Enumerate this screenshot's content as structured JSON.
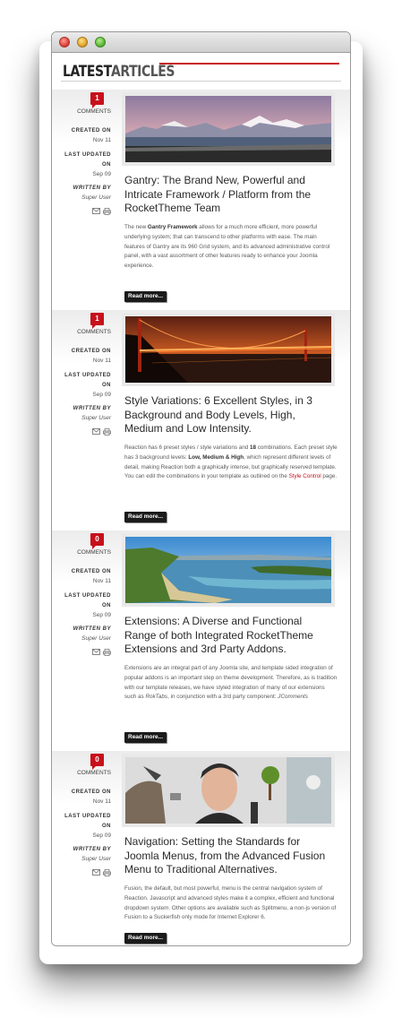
{
  "header": {
    "title_strong": "LATEST",
    "title_light": "ARTICLES"
  },
  "colors": {
    "accent": "#c7101b",
    "dark_button": "#1b1b1b"
  },
  "meta_labels": {
    "comments": "COMMENTS",
    "created": "CREATED ON",
    "updated_1": "LAST UPDATED",
    "updated_2": "ON",
    "written": "WRITTEN BY"
  },
  "icons": [
    "email-icon",
    "print-icon"
  ],
  "articles": [
    {
      "comments": "1",
      "created": "Nov 11",
      "updated": "Sep 09",
      "author": "Super User",
      "image": "snowy-mountains-lake",
      "title": "Gantry: The Brand New, Powerful and Intricate Framework / Platform from the RocketTheme Team",
      "desc_1": "The new ",
      "desc_b1": "Gantry Framework",
      "desc_2": " allows for a much more efficient, more powerful underlying system; that can transcend to other platforms with ease. The main features of Gantry are its 960 Grid system, and its advanced administrative control panel, with a vast assortment of other features ready to enhance your Joomla experience.",
      "readmore": "Read more..."
    },
    {
      "comments": "1",
      "created": "Nov 11",
      "updated": "Sep 09",
      "author": "Super User",
      "image": "golden-gate-bridge-night",
      "title": "Style Variations: 6 Excellent Styles, in 3 Background and Body Levels, High, Medium and Low Intensity.",
      "desc_1": "Reaction has 6 preset styles / style variations and ",
      "desc_b1": "18",
      "desc_2": " combinations. Each preset style has 3 background levels: ",
      "desc_b2": "Low, Medium & High",
      "desc_3": ", which represent different levels of detail, making Reaction both a graphically intense, but graphically reserved template. You can edit the combinations in your template as outlined on the ",
      "desc_link": "Style Control",
      "desc_4": " page.",
      "readmore": "Read more..."
    },
    {
      "comments": "0",
      "created": "Nov 11",
      "updated": "Sep 09",
      "author": "Super User",
      "image": "coastal-lagoon",
      "title": "Extensions: A Diverse and Functional Range of both Integrated RocketTheme Extensions and 3rd Party Addons.",
      "desc_1": "Extensions are an integral part of any Joomla site, and template sided integration of popular addons is an important step on theme development. Therefore, as is tradition with our template releases, we have styled integration of many of our extensions such as ",
      "desc_i1": "RokTabs",
      "desc_2": ", in conjunction with a 3rd party component: ",
      "desc_i2": "JComments",
      "readmore": "Read more..."
    },
    {
      "comments": "0",
      "created": "Nov 11",
      "updated": "Sep 09",
      "author": "Super User",
      "image": "surreal-collage-man",
      "title": "Navigation: Setting the Standards for Joomla Menus, from the Advanced Fusion Menu to Traditional Alternatives.",
      "desc_1": "Fusion, the default, but most powerful, menu is the central navigation system of Reaction. Javascript and advanced styles make it a complex, efficient and functional dropdown system. Other options are available such as Splitmenu, a non-js version of Fusion to a Suckerfish only mode for Internet Explorer 6.",
      "readmore": "Read more..."
    }
  ]
}
